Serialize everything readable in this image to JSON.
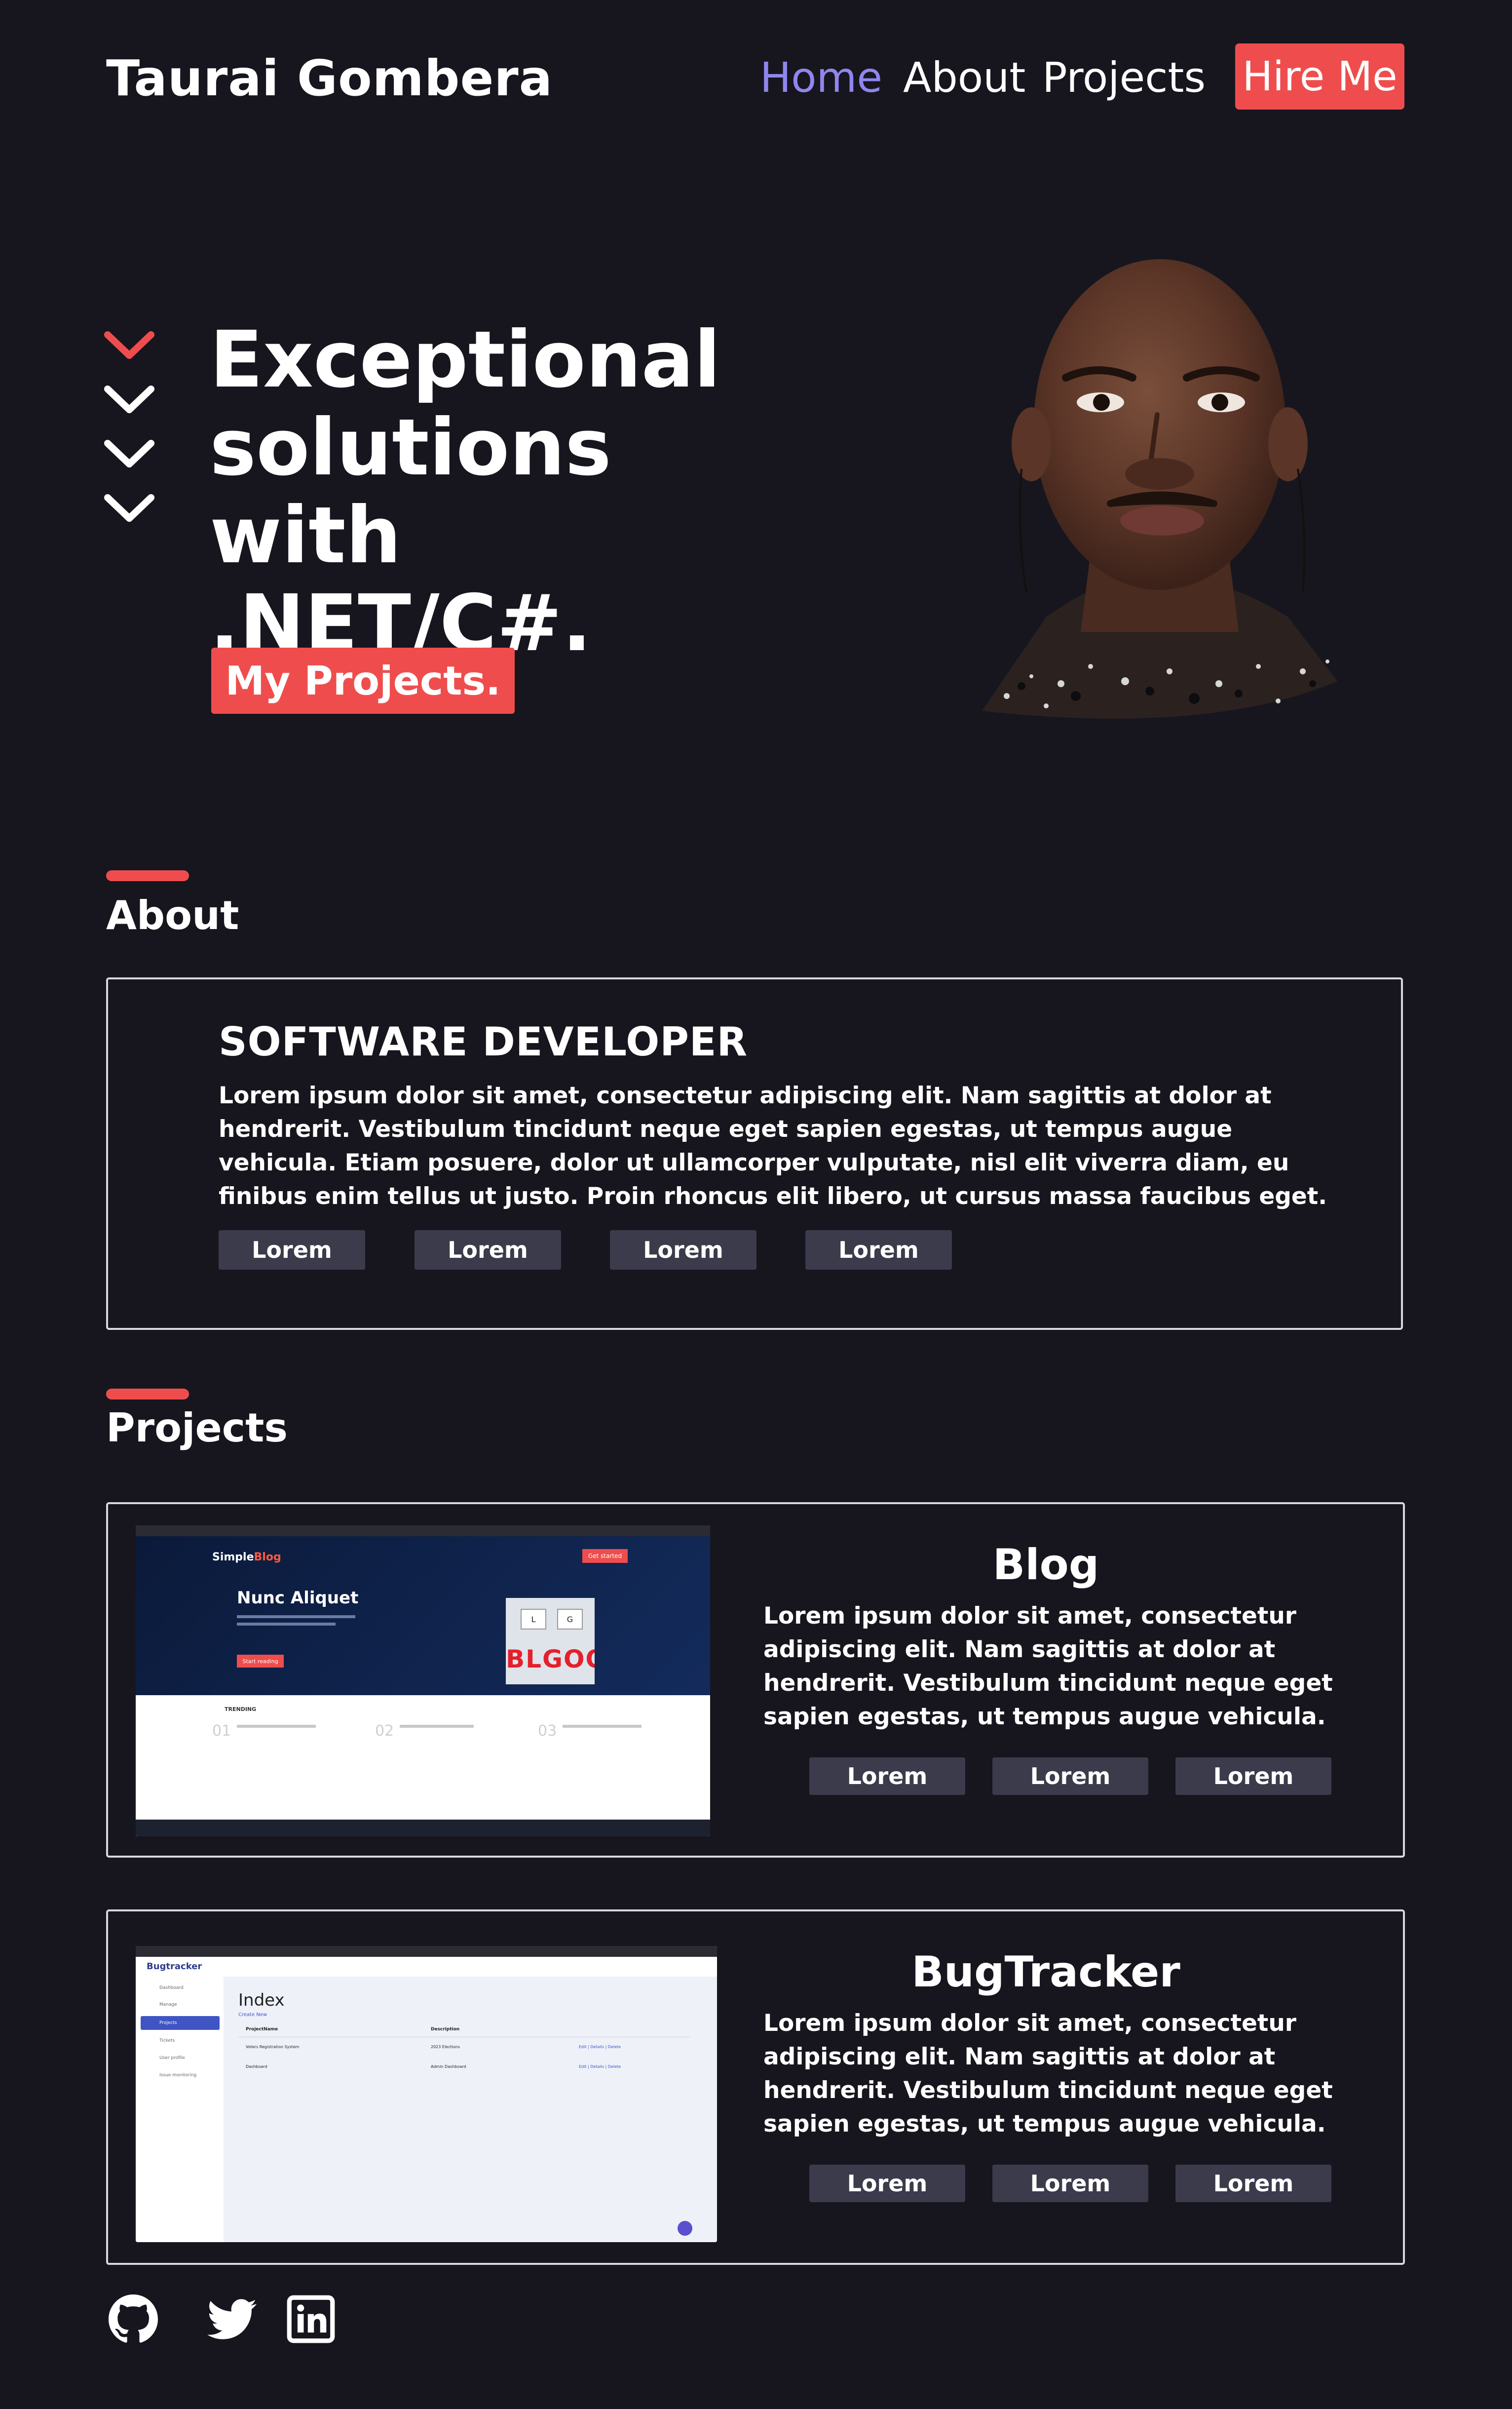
{
  "header": {
    "brand": "Taurai Gombera",
    "nav": [
      "Home",
      "About",
      "Projects"
    ],
    "hire": "Hire Me"
  },
  "hero": {
    "title_lines": [
      "Exceptional",
      "solutions with",
      ".NET/C#."
    ],
    "cta": "My Projects."
  },
  "about": {
    "heading": "About",
    "role": "SOFTWARE DEVELOPER",
    "text": "Lorem ipsum dolor sit amet, consectetur adipiscing elit. Nam sagittis at dolor at hendrerit. Vestibulum tincidunt neque eget sapien egestas, ut tempus augue vehicula. Etiam posuere, dolor ut ullamcorper vulputate, nisl elit viverra diam, eu finibus enim tellus ut justo. Proin rhoncus elit libero, ut cursus massa faucibus eget.",
    "tags": [
      "Lorem",
      "Lorem",
      "Lorem",
      "Lorem"
    ]
  },
  "projects": {
    "heading": "Projects",
    "items": [
      {
        "title": "Blog",
        "text": "Lorem ipsum dolor sit amet, consectetur adipiscing elit. Nam sagittis at dolor at hendrerit. Vestibulum tincidunt neque eget sapien egestas, ut tempus augue vehicula.",
        "tags": [
          "Lorem",
          "Lorem",
          "Lorem"
        ],
        "shot": {
          "logo_a": "Simple",
          "logo_b": "Blog",
          "headline": "Nunc Aliquet",
          "cta": "Get started",
          "read": "Start reading",
          "trending": "TRENDING",
          "nums": [
            "01",
            "02",
            "03"
          ],
          "keys": [
            "L",
            "G"
          ],
          "key_word": "BLGOO"
        }
      },
      {
        "title": "BugTracker",
        "text": "Lorem ipsum dolor sit amet, consectetur adipiscing elit. Nam sagittis at dolor at hendrerit. Vestibulum tincidunt neque eget sapien egestas, ut tempus augue vehicula.",
        "tags": [
          "Lorem",
          "Lorem",
          "Lorem"
        ],
        "shot": {
          "logo": "Bugtracker",
          "page_title": "Index",
          "create": "Create New",
          "col_a": "ProjectName",
          "col_b": "Description",
          "rows": [
            [
              "Voters Registration System",
              "2023 Elections",
              "Edit | Details | Delete"
            ],
            [
              "Dashboard",
              "Admin Dashboard",
              "Edit | Details | Delete"
            ]
          ],
          "side": [
            "Dashboard",
            "Manage",
            "Projects",
            "Tickets",
            "User profile",
            "Issue monitoring"
          ]
        }
      }
    ]
  },
  "footer": {
    "icons": [
      "github-icon",
      "twitter-icon",
      "linkedin-icon"
    ]
  },
  "colors": {
    "background": "#17161e",
    "accent": "#ef4d4d",
    "nav_active": "#8f86ee",
    "tag_bg": "#3c3b4c"
  }
}
